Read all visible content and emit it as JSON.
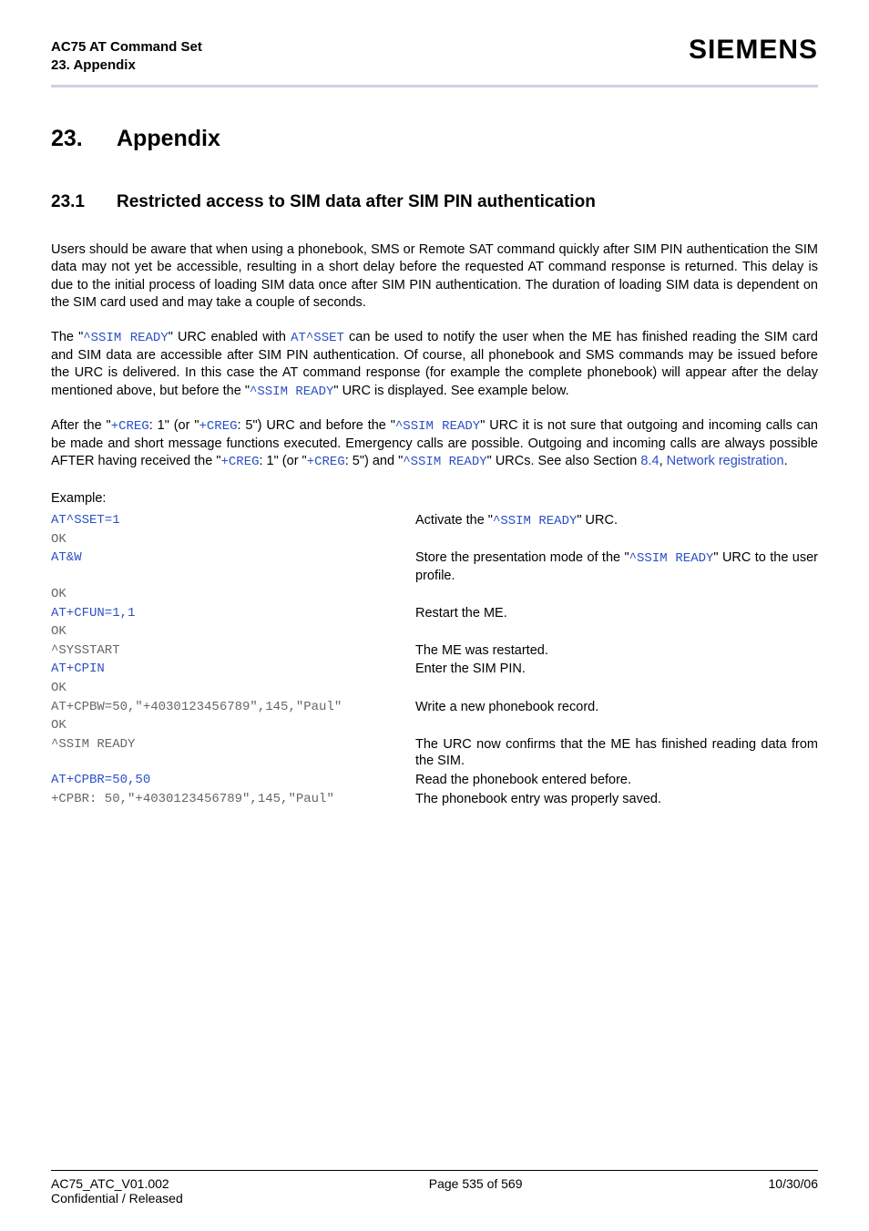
{
  "header": {
    "title": "AC75 AT Command Set",
    "subtitle": "23. Appendix",
    "brand": "SIEMENS"
  },
  "chapter": {
    "num": "23.",
    "title": "Appendix"
  },
  "section": {
    "num": "23.1",
    "title": "Restricted access to SIM data after SIM PIN authentication"
  },
  "para1": "Users should be aware that when using a phonebook, SMS or Remote SAT command quickly after SIM PIN authentication the SIM data may not yet be accessible, resulting in a short delay before the requested AT command response is returned. This delay is due to the initial process of loading SIM data once after SIM PIN authentication. The duration of loading SIM data is dependent on the SIM card used and may take a couple of seconds.",
  "para2": {
    "a": "The \"",
    "b": "^SSIM READY",
    "c": "\" URC enabled with ",
    "d": "AT^SSET",
    "e": " can be used to notify the user when the ME has finished reading the SIM card and SIM data are accessible after SIM PIN authentication. Of course, all phonebook and SMS commands may be issued before the URC is delivered. In this case the AT command response (for example the complete phonebook) will appear after the delay mentioned above, but before the \"",
    "f": "^SSIM READY",
    "g": "\" URC is displayed. See example below."
  },
  "para3": {
    "a": "After the \"",
    "b": "+CREG",
    "c": ": 1\" (or \"",
    "d": "+CREG",
    "e": ": 5\") URC and before the \"",
    "f": "^SSIM READY",
    "g": "\" URC it is not sure that outgoing and incoming calls can be made and short message functions executed. Emergency calls are possible. Outgoing and incoming calls are always possible AFTER having received the \"",
    "h": "+CREG",
    "i": ": 1\" (or \"",
    "j": "+CREG",
    "k": ": 5\") and \"",
    "l": "^SSIM READY",
    "m": "\" URCs. See also Section ",
    "n": "8.4",
    "o": ", ",
    "p": "Network registration",
    "q": "."
  },
  "exampleLabel": "Example:",
  "rows": [
    {
      "cmd": "AT^SSET=1",
      "cmdClass": "link",
      "desc_a": "Activate the \"",
      "desc_b": "^SSIM READY",
      "desc_c": "\" URC."
    },
    {
      "cmd": "OK",
      "cmdClass": "gray",
      "desc_a": "",
      "desc_b": "",
      "desc_c": ""
    },
    {
      "cmd": "AT&W",
      "cmdClass": "link",
      "desc_a": "Store the presentation mode of the \"",
      "desc_b": "^SSIM READY",
      "desc_c": "\" URC to the user profile."
    },
    {
      "cmd": "OK",
      "cmdClass": "gray",
      "desc_a": "",
      "desc_b": "",
      "desc_c": ""
    },
    {
      "cmd": "AT+CFUN=1,1",
      "cmdClass": "link",
      "desc_a": "Restart the ME.",
      "desc_b": "",
      "desc_c": ""
    },
    {
      "cmd": "OK",
      "cmdClass": "gray",
      "desc_a": "",
      "desc_b": "",
      "desc_c": ""
    },
    {
      "cmd": "^SYSSTART",
      "cmdClass": "gray",
      "desc_a": "The ME was restarted.",
      "desc_b": "",
      "desc_c": ""
    },
    {
      "cmd": "AT+CPIN",
      "cmdClass": "link",
      "desc_a": "Enter the SIM PIN.",
      "desc_b": "",
      "desc_c": ""
    },
    {
      "cmd": "OK",
      "cmdClass": "gray",
      "desc_a": "",
      "desc_b": "",
      "desc_c": ""
    },
    {
      "cmd": "AT+CPBW=50,\"+4030123456789\",145,\"Paul\"",
      "cmdClass": "gray",
      "desc_a": "Write a new phonebook record.",
      "desc_b": "",
      "desc_c": ""
    },
    {
      "cmd": "OK",
      "cmdClass": "gray",
      "desc_a": "",
      "desc_b": "",
      "desc_c": ""
    },
    {
      "cmd": "^SSIM READY",
      "cmdClass": "gray",
      "desc_a": "The URC now confirms that the ME has finished reading data from the SIM.",
      "desc_b": "",
      "desc_c": ""
    },
    {
      "cmd": "AT+CPBR=50,50",
      "cmdClass": "link",
      "desc_a": "Read the phonebook entered before.",
      "desc_b": "",
      "desc_c": ""
    },
    {
      "cmd": "+CPBR: 50,\"+4030123456789\",145,\"Paul\"",
      "cmdClass": "gray",
      "desc_a": "The phonebook entry was properly saved.",
      "desc_b": "",
      "desc_c": ""
    }
  ],
  "footer": {
    "leftTop": "AC75_ATC_V01.002",
    "leftBottom": "Confidential / Released",
    "center": "Page 535 of 569",
    "right": "10/30/06"
  }
}
